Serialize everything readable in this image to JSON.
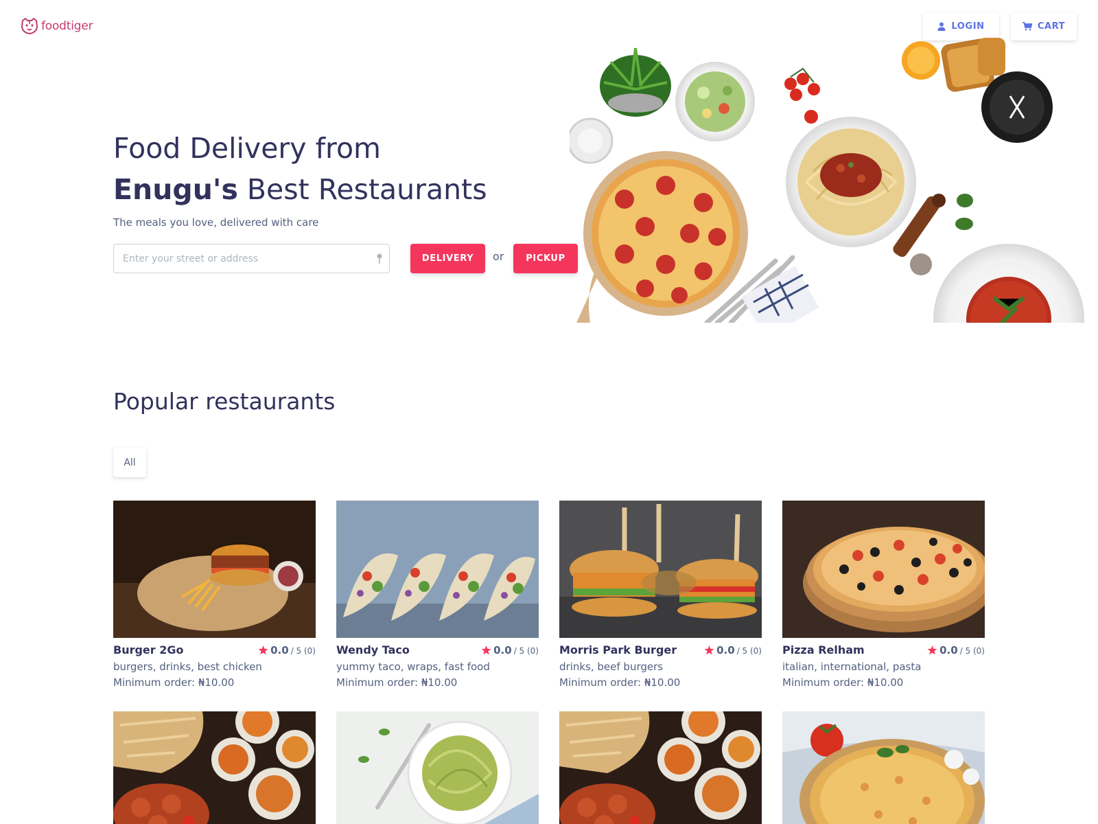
{
  "header": {
    "brand": "foodtiger",
    "login_label": "LOGIN",
    "cart_label": "CART"
  },
  "hero": {
    "title_line1": "Food Delivery from",
    "title_bold": "Enugu's",
    "title_rest": " Best Restaurants",
    "subtitle": "The meals you love, delivered with care",
    "address_placeholder": "Enter your street or address",
    "delivery_label": "DELIVERY",
    "or_label": "or",
    "pickup_label": "PICKUP"
  },
  "popular": {
    "title": "Popular restaurants",
    "filter_all": "All",
    "restaurants": [
      {
        "name": "Burger 2Go",
        "rating": "0.0",
        "rating_of": "/ 5 (0)",
        "tags": "burgers, drinks, best chicken",
        "min_order": "Minimum order: ₦10.00",
        "image": "burger-fries"
      },
      {
        "name": "Wendy Taco",
        "rating": "0.0",
        "rating_of": "/ 5 (0)",
        "tags": "yummy taco, wraps, fast food",
        "min_order": "Minimum order: ₦10.00",
        "image": "tacos"
      },
      {
        "name": "Morris Park Burger",
        "rating": "0.0",
        "rating_of": "/ 5 (0)",
        "tags": "drinks, beef burgers",
        "min_order": "Minimum order: ₦10.00",
        "image": "mini-burgers"
      },
      {
        "name": "Pizza Relham",
        "rating": "0.0",
        "rating_of": "/ 5 (0)",
        "tags": "italian, international, pasta",
        "min_order": "Minimum order: ₦10.00",
        "image": "olive-pizza"
      },
      {
        "image": "indian-food"
      },
      {
        "image": "pesto-pasta"
      },
      {
        "image": "indian-food"
      },
      {
        "image": "tomato-pizza"
      }
    ]
  },
  "colors": {
    "primary": "#5e72e4",
    "accent": "#f5365c",
    "brand": "#c43a6f",
    "heading": "#32325d",
    "text": "#525f7f"
  }
}
